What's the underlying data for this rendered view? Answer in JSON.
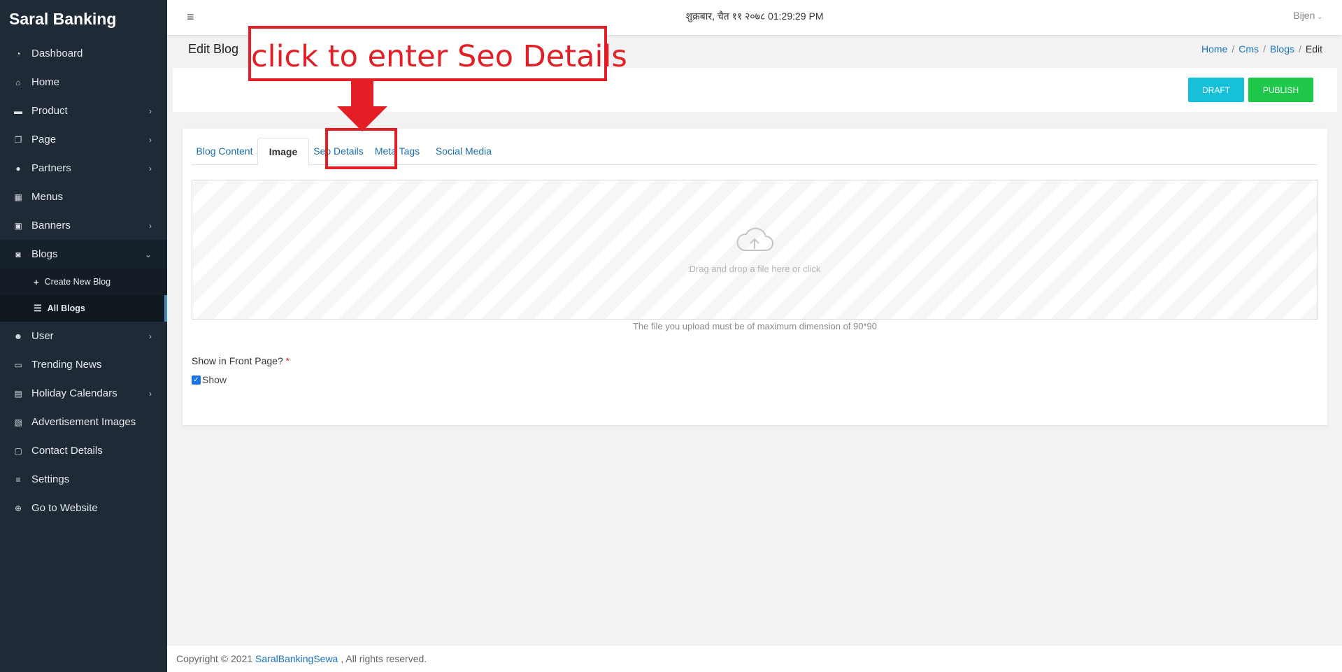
{
  "sidebar": {
    "brand": "Saral Banking",
    "items": [
      {
        "label": "Dashboard",
        "icon": "dashboard-icon"
      },
      {
        "label": "Home",
        "icon": "home-icon"
      },
      {
        "label": "Product",
        "icon": "product-icon"
      },
      {
        "label": "Page",
        "icon": "page-icon"
      },
      {
        "label": "Partners",
        "icon": "partners-icon"
      },
      {
        "label": "Menus",
        "icon": "grid-icon"
      },
      {
        "label": "Banners",
        "icon": "banners-icon"
      },
      {
        "label": "Blogs",
        "icon": "blogs-icon"
      },
      {
        "label": "User",
        "icon": "users-icon"
      },
      {
        "label": "Trending News",
        "icon": "news-icon"
      },
      {
        "label": "Holiday Calendars",
        "icon": "calendar-icon"
      },
      {
        "label": "Advertisement Images",
        "icon": "ad-icon"
      },
      {
        "label": "Contact Details",
        "icon": "contact-icon"
      },
      {
        "label": "Settings",
        "icon": "settings-icon"
      },
      {
        "label": "Go to Website",
        "icon": "globe-icon"
      }
    ],
    "blog_sub": {
      "create": "Create New Blog",
      "all": "All Blogs"
    }
  },
  "topbar": {
    "datetime": "शुक्रबार, चैत ११ २०७८ 01:29:29 PM",
    "user": "Bijen"
  },
  "header": {
    "title": "Edit Blog",
    "breadcrumb": [
      "Home",
      "Cms",
      "Blogs",
      "Edit"
    ]
  },
  "actions": {
    "draft": "DRAFT",
    "publish": "PUBLISH"
  },
  "tabs": [
    "Blog Content",
    "Image",
    "Seo Details",
    "Meta Tags",
    "Social Media"
  ],
  "upload": {
    "dropzone_text": "Drag and drop a file here or click",
    "hint": "The file you upload must be of maximum dimension of 90*90"
  },
  "form": {
    "front_page_label": "Show in Front Page?",
    "required_mark": "*",
    "show_label": "Show",
    "show_checked": true
  },
  "footer": {
    "prefix": "Copyright © 2021 ",
    "link": "SaralBankingSewa",
    "suffix": " , All rights reserved."
  },
  "annotation": {
    "text": "click to enter Seo Details",
    "color": "#e31e24"
  },
  "colors": {
    "sidebar_bg": "#1e2a36",
    "draft_btn": "#17c0d9",
    "publish_btn": "#1ec84a",
    "link": "#1a73c8"
  }
}
